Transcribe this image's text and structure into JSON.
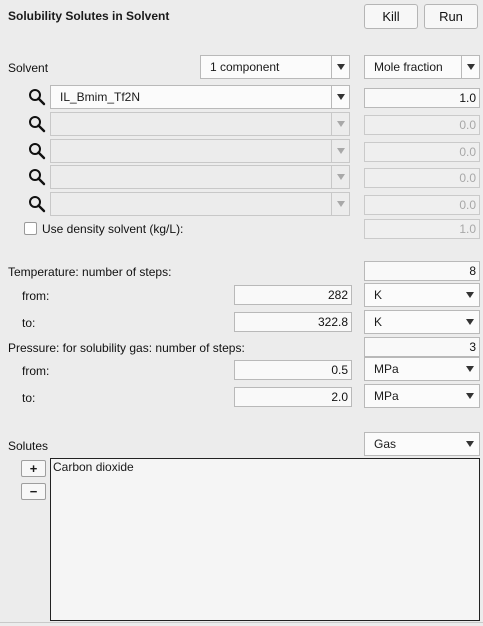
{
  "title": "Solubility Solutes in Solvent",
  "buttons": {
    "kill": "Kill",
    "run": "Run"
  },
  "solvent": {
    "label": "Solvent",
    "components_select": "1 component",
    "fraction_select": "Mole fraction",
    "rows": [
      {
        "name": "IL_Bmim_Tf2N",
        "value": "1.0",
        "enabled": true
      },
      {
        "name": "",
        "value": "0.0",
        "enabled": false
      },
      {
        "name": "",
        "value": "0.0",
        "enabled": false
      },
      {
        "name": "",
        "value": "0.0",
        "enabled": false
      },
      {
        "name": "",
        "value": "0.0",
        "enabled": false
      }
    ],
    "density_label": "Use density solvent (kg/L):",
    "density_value": "1.0",
    "density_checked": false
  },
  "temperature": {
    "label": "Temperature: number of steps:",
    "steps": "8",
    "from_label": "from:",
    "from_value": "282",
    "from_unit": "K",
    "to_label": "to:",
    "to_value": "322.8",
    "to_unit": "K"
  },
  "pressure": {
    "label": "Pressure: for solubility gas: number of steps:",
    "steps": "3",
    "from_label": "from:",
    "from_value": "0.5",
    "from_unit": "MPa",
    "to_label": "to:",
    "to_value": "2.0",
    "to_unit": "MPa"
  },
  "solutes": {
    "label": "Solutes",
    "phase_select": "Gas",
    "add_label": "+",
    "remove_label": "−",
    "items": [
      "Carbon dioxide"
    ]
  }
}
